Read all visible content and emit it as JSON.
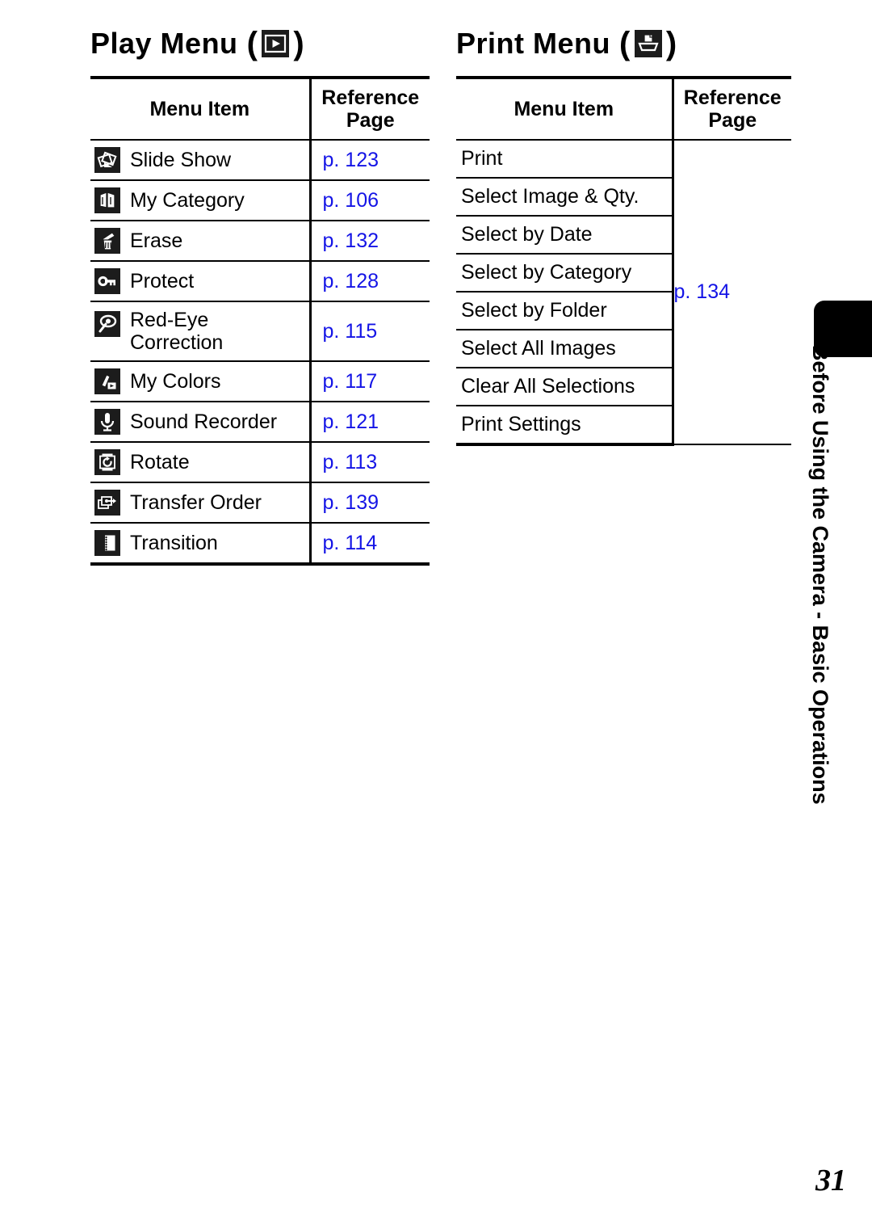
{
  "page": {
    "number": "31",
    "side_tab_label": "Before Using the Camera - Basic Operations",
    "link_color": "#1414e6"
  },
  "play_menu": {
    "title": "Play Menu",
    "title_icon": "playback-icon",
    "paren_open": "(",
    "paren_close": ")",
    "columns": {
      "item": "Menu Item",
      "reference_line1": "Reference",
      "reference_line2": "Page"
    },
    "rows": [
      {
        "icon": "slide-show-icon",
        "label": "Slide Show",
        "ref": "p. 123"
      },
      {
        "icon": "my-category-icon",
        "label": "My Category",
        "ref": "p. 106"
      },
      {
        "icon": "erase-icon",
        "label": "Erase",
        "ref": "p. 132"
      },
      {
        "icon": "protect-key-icon",
        "label": "Protect",
        "ref": "p. 128"
      },
      {
        "icon": "red-eye-correction-icon",
        "label": "Red-Eye",
        "label2": "Correction",
        "ref": "p. 115"
      },
      {
        "icon": "my-colors-icon",
        "label": "My Colors",
        "ref": "p. 117"
      },
      {
        "icon": "sound-recorder-icon",
        "label": "Sound Recorder",
        "ref": "p. 121"
      },
      {
        "icon": "rotate-icon",
        "label": "Rotate",
        "ref": "p. 113"
      },
      {
        "icon": "transfer-order-icon",
        "label": "Transfer Order",
        "ref": "p. 139"
      },
      {
        "icon": "transition-icon",
        "label": "Transition",
        "ref": "p. 114"
      }
    ]
  },
  "print_menu": {
    "title": "Print Menu",
    "title_icon": "print-icon",
    "paren_open": "(",
    "paren_close": ")",
    "columns": {
      "item": "Menu Item",
      "reference_line1": "Reference",
      "reference_line2": "Page"
    },
    "shared_ref": "p. 134",
    "rows": [
      {
        "label": "Print"
      },
      {
        "label": "Select Image & Qty."
      },
      {
        "label": "Select by Date"
      },
      {
        "label": "Select by Category"
      },
      {
        "label": "Select by Folder"
      },
      {
        "label": "Select All Images"
      },
      {
        "label": "Clear All Selections"
      },
      {
        "label": "Print Settings"
      }
    ]
  }
}
